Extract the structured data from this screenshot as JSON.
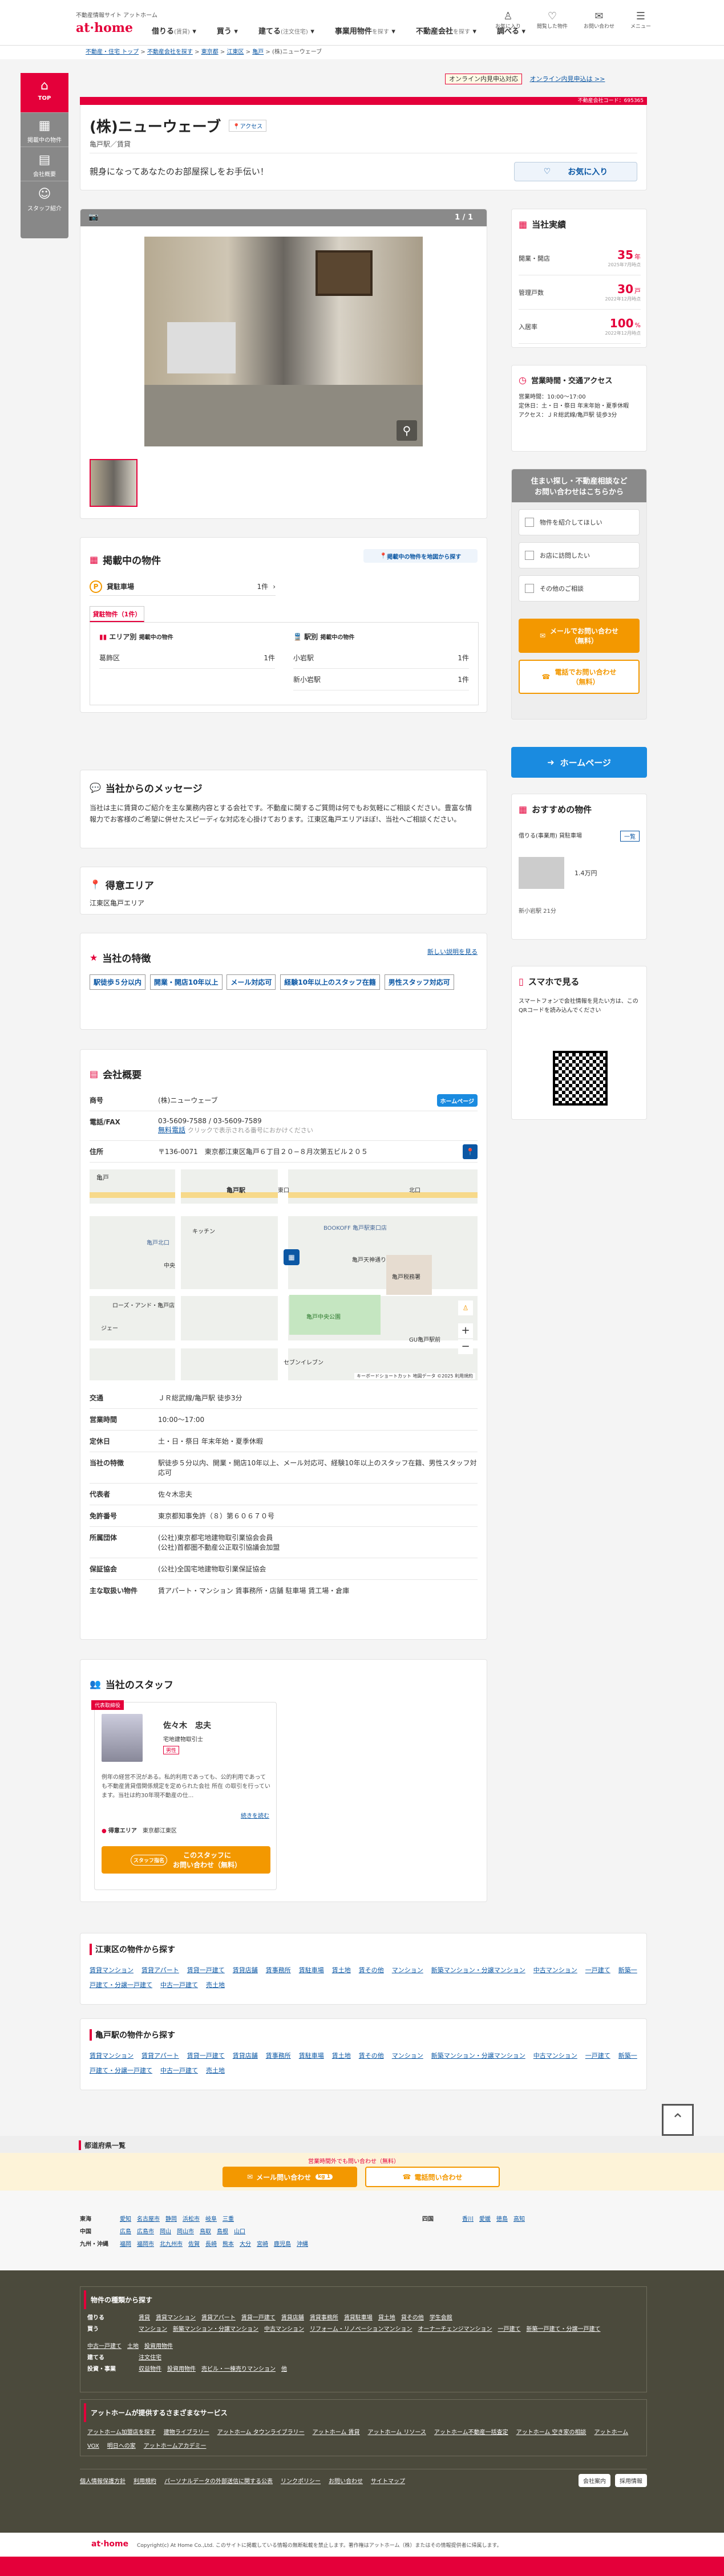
{
  "header": {
    "site_sub": "不動産情報サイト アットホーム",
    "logo": "at·home",
    "nav": [
      {
        "label": "借りる",
        "sub": "(賃貸)"
      },
      {
        "label": "買う",
        "sub": ""
      },
      {
        "label": "建てる",
        "sub": "(注文住宅)"
      },
      {
        "label": "事業用物件",
        "sub": "を探す"
      },
      {
        "label": "不動産会社",
        "sub": "を探す"
      },
      {
        "label": "調べる",
        "sub": ""
      }
    ],
    "icons": [
      {
        "name": "user-icon",
        "label": "お気に入り"
      },
      {
        "name": "heart-icon",
        "label": "閲覧した物件"
      },
      {
        "name": "mail-icon",
        "label": "お問い合わせ"
      },
      {
        "name": "menu-icon",
        "label": "メニュー"
      }
    ]
  },
  "breadcrumb": [
    "不動産・住宅 トップ",
    "不動産会社を探す",
    "東京都",
    "江東区",
    "亀戸",
    "(株)ニューウェーブ"
  ],
  "sidenav": [
    {
      "label": "TOP",
      "icon": "home-icon"
    },
    {
      "label": "掲載中の物件",
      "icon": "building-icon"
    },
    {
      "label": "会社概要",
      "icon": "doc-icon"
    },
    {
      "label": "スタッフ紹介",
      "icon": "person-icon"
    }
  ],
  "top_cta": {
    "badge": "オンライン内見申込対応",
    "link": "オンライン内見申込は >>"
  },
  "company_code": "不動産会社コード：695365",
  "company": {
    "name": "(株)ニューウェーブ",
    "access": "アクセス",
    "station": "亀戸駅／賃貸",
    "catch": "親身になってあなたのお部屋探しをお手伝い！",
    "fav": "お気に入り"
  },
  "gallery": {
    "count": "1 / 1"
  },
  "listings": {
    "title": "掲載中の物件",
    "map_btn": "掲載中の物件を地図から探す",
    "category": "貸駐車場",
    "count": "1件",
    "tab": "貸駐物件（1件）",
    "area_title": "エリア別",
    "area_sub": "掲載中の物件",
    "station_title": "駅別",
    "station_sub": "掲載中の物件",
    "areas": [
      {
        "name": "葛飾区",
        "n": "1件"
      }
    ],
    "stations": [
      {
        "name": "小岩駅",
        "n": "1件"
      },
      {
        "name": "新小岩駅",
        "n": "1件"
      }
    ]
  },
  "message": {
    "title": "当社からのメッセージ",
    "body": "当社は主に賃貸のご紹介を主な業務内容とする会社です。不動産に関するご質問は何でもお気軽にご相談ください。豊富な情報力でお客様のご希望に併せたスピーディな対応を心掛けております。江東区亀戸エリアほぼ!、当社へご相談ください。"
  },
  "area": {
    "title": "得意エリア",
    "body": "江東区亀戸エリア"
  },
  "features": {
    "title": "当社の特徴",
    "link": "新しい説明を見る",
    "tags": [
      "駅徒歩５分以内",
      "開業・開店10年以上",
      "メール対応可",
      "経験10年以上のスタッフ在籍",
      "男性スタッフ対応可"
    ]
  },
  "profile": {
    "title": "会社概要",
    "hp": "ホームページ",
    "rows": [
      {
        "k": "商号",
        "v": "(株)ニューウェーブ"
      },
      {
        "k": "電話/FAX",
        "v": "03-5609-7588 / 03-5609-7589"
      },
      {
        "k": "住所",
        "v": "〒136-0071　東京都江東区亀戸６丁目２０−８月次第五ビル２０５"
      }
    ],
    "tel_link": "無料電話",
    "tel_note": "クリックで表示される番号におかけください",
    "map_labels": [
      "亀戸",
      "亀戸駅",
      "東口",
      "北口",
      "BOOKOFF 亀戸駅東口店",
      "亀戸中央公園",
      "亀戸税務署",
      "亀戸北口",
      "ローズ・アンド・亀戸店",
      "ジェー",
      "中央",
      "GU亀戸駅前",
      "セブンイレブン",
      "キッチン",
      "亀戸天神通り"
    ],
    "map_footer": "キーボードショートカット  地図データ ©2025  利用規約",
    "rows2": [
      {
        "k": "交通",
        "v": "ＪＲ総武線/亀戸駅 徒歩3分"
      },
      {
        "k": "営業時間",
        "v": "10:00〜17:00"
      },
      {
        "k": "定休日",
        "v": "土・日・祭日 年末年始・夏季休暇"
      },
      {
        "k": "当社の特徴",
        "v": "駅徒歩５分以内、開業・開店10年以上、メール対応可、経験10年以上のスタッフ在籍、男性スタッフ対応可"
      },
      {
        "k": "代表者",
        "v": "佐々木忠夫"
      },
      {
        "k": "免許番号",
        "v": "東京都知事免許（８）第６０６７０号"
      },
      {
        "k": "所属団体",
        "v": "(公社)東京都宅地建物取引業協会会員\n(公社)首都圏不動産公正取引協議会加盟"
      },
      {
        "k": "保証協会",
        "v": "(公社)全国宅地建物取引業保証協会"
      },
      {
        "k": "主な取扱い物件",
        "v": "賃アパート・マンション 賃事務所・店舗 駐車場 賃工場・倉庫"
      }
    ]
  },
  "staff": {
    "title": "当社のスタッフ",
    "ribbon": "代表取締役",
    "name": "佐々木　忠夫",
    "cert": "宅地建物取引士",
    "tag": "男性",
    "body": "例年の経営不況がある。私的利用であっても、公的利用であっても不動産賃貸借関係規定を定められた会社 所在 の取引を行っています。当社は約30年現不動産の仕...",
    "more": "続きを読む",
    "area_k": "得意エリア",
    "area_v": "東京都江東区",
    "btn_small": "スタッフ指名",
    "btn": "このスタッフに\nお問い合わせ（無料）"
  },
  "kotoku": {
    "title": "江東区の物件から探す",
    "links": [
      "賃貸マンション",
      "賃貸アパート",
      "賃貸一戸建て",
      "賃貸店舗",
      "賃事務所",
      "賃駐車場",
      "賃土地",
      "賃その他",
      "マンション",
      "新築マンション・分譲マンション",
      "中古マンション",
      "一戸建て",
      "新築一戸建て・分譲一戸建て",
      "中古一戸建て",
      "売土地"
    ]
  },
  "kameido": {
    "title": "亀戸駅の物件から探す",
    "links": [
      "賃貸マンション",
      "賃貸アパート",
      "賃貸一戸建て",
      "賃貸店舗",
      "賃事務所",
      "賃駐車場",
      "賃土地",
      "賃その他",
      "マンション",
      "新築マンション・分譲マンション",
      "中古マンション",
      "一戸建て",
      "新築一戸建て・分譲一戸建て",
      "中古一戸建て",
      "売土地"
    ]
  },
  "sidebar": {
    "results": {
      "title": "当社実績",
      "items": [
        {
          "k": "開業・開店",
          "v": "35",
          "u": "年",
          "note": "2025年7月時点"
        },
        {
          "k": "管理戸数",
          "v": "30",
          "u": "戸",
          "note": "2022年12月時点"
        },
        {
          "k": "入居率",
          "v": "100",
          "u": "%",
          "note": "2022年12月時点"
        }
      ]
    },
    "hours": {
      "title": "営業時間・交通アクセス",
      "body": "営業時間：10:00〜17:00\n定休日：土・日・祭日 年末年始・夏季休暇\nアクセス：ＪＲ総武線/亀戸駅 徒歩3分"
    },
    "inquiry": {
      "head": "住まい探し・不動産相談など\nお問い合わせはこちらから",
      "opts": [
        "物件を紹介してほしい",
        "お店に訪問したい",
        "その他のご相談"
      ],
      "mail": "メールでお問い合わせ\n（無料）",
      "tel": "電話でお問い合わせ\n（無料）"
    },
    "homepage": "ホームページ",
    "recommend": {
      "title": "おすすめの物件",
      "prop": "借りる(事業用) 貸駐車場",
      "more": "一覧",
      "price": "1.4万円",
      "station": "新小岩駅 21分"
    },
    "mobile": {
      "title": "スマホで見る",
      "body": "スマートフォンで会社情報を見たい方は、このQRコードを読み込んでください"
    }
  },
  "footer": {
    "sticky_note": "営業時間外でも問い合わせ（無料）",
    "sticky_mail": "メール問い合わせ",
    "sticky_badge": "kg 1",
    "sticky_tel": "電話問い合わせ",
    "pref_title": "都道府県一覧",
    "regions": [
      {
        "k": "東海",
        "v": [
          "愛知",
          "名古屋市",
          "静岡",
          "浜松市",
          "岐阜",
          "三重"
        ]
      },
      {
        "k": "中国",
        "v": [
          "広島",
          "広島市",
          "岡山",
          "岡山市",
          "鳥取",
          "島根",
          "山口"
        ]
      },
      {
        "k": "九州・沖縄",
        "v": [
          "福岡",
          "福岡市",
          "北九州市",
          "佐賀",
          "長崎",
          "熊本",
          "大分",
          "宮崎",
          "鹿児島",
          "沖縄"
        ]
      }
    ],
    "regions_r": [
      {
        "k": "四国",
        "v": [
          "香川",
          "愛媛",
          "徳島",
          "高知"
        ]
      }
    ],
    "find_title": "物件の種類から探す",
    "find_rows": [
      {
        "k": "借りる",
        "v": [
          "賃貸",
          "賃貸マンション",
          "賃貸アパート",
          "賃貸一戸建て",
          "賃貸店舗",
          "賃貸事務所",
          "賃貸駐車場",
          "貸土地",
          "貸その他",
          "学生会館"
        ]
      },
      {
        "k": "買う",
        "v": [
          "マンション",
          "新築マンション・分譲マンション",
          "中古マンション",
          "リフォーム・リノベーションマンション",
          "オーナーチェンジマンション",
          "一戸建て",
          "新築一戸建て・分譲一戸建て",
          "中古一戸建て",
          "土地",
          "投資用物件"
        ]
      },
      {
        "k": "建てる",
        "v": [
          "注文住宅"
        ]
      },
      {
        "k": "投資・事業",
        "v": [
          "収益物件",
          "投資用物件",
          "売ビル・一棟売りマンション",
          "他"
        ]
      }
    ],
    "service_title": "アットホームが提供するさまざまなサービス",
    "services": [
      "アットホーム加盟店を探す",
      "建物ライブラリー",
      "アットホーム タウンライブラリー",
      "アットホーム 賃貸",
      "アットホーム リソース",
      "アットホーム不動産一括査定",
      "アットホーム 空き家の相談",
      "アットホーム VOX",
      "明日への家",
      "アットホームアカデミー"
    ],
    "bottom": [
      "個人情報保護方針",
      "利用規約",
      "パーソナルデータの外部送信に関する公表",
      "リンクポリシー",
      "お問い合わせ",
      "サイトマップ"
    ],
    "btn1": "会社案内",
    "btn2": "採用情報",
    "copy": "Copyright(c) At Home Co.,Ltd. このサイトに掲載している情報の無断転載を禁止します。著作権はアットホーム（株）またはその情報提供者に帰属します。"
  },
  "colors": {
    "brand": "#e4003a",
    "link": "#0b57a4",
    "cta_orange": "#f39800",
    "footer_dark": "#4b4a3c"
  }
}
